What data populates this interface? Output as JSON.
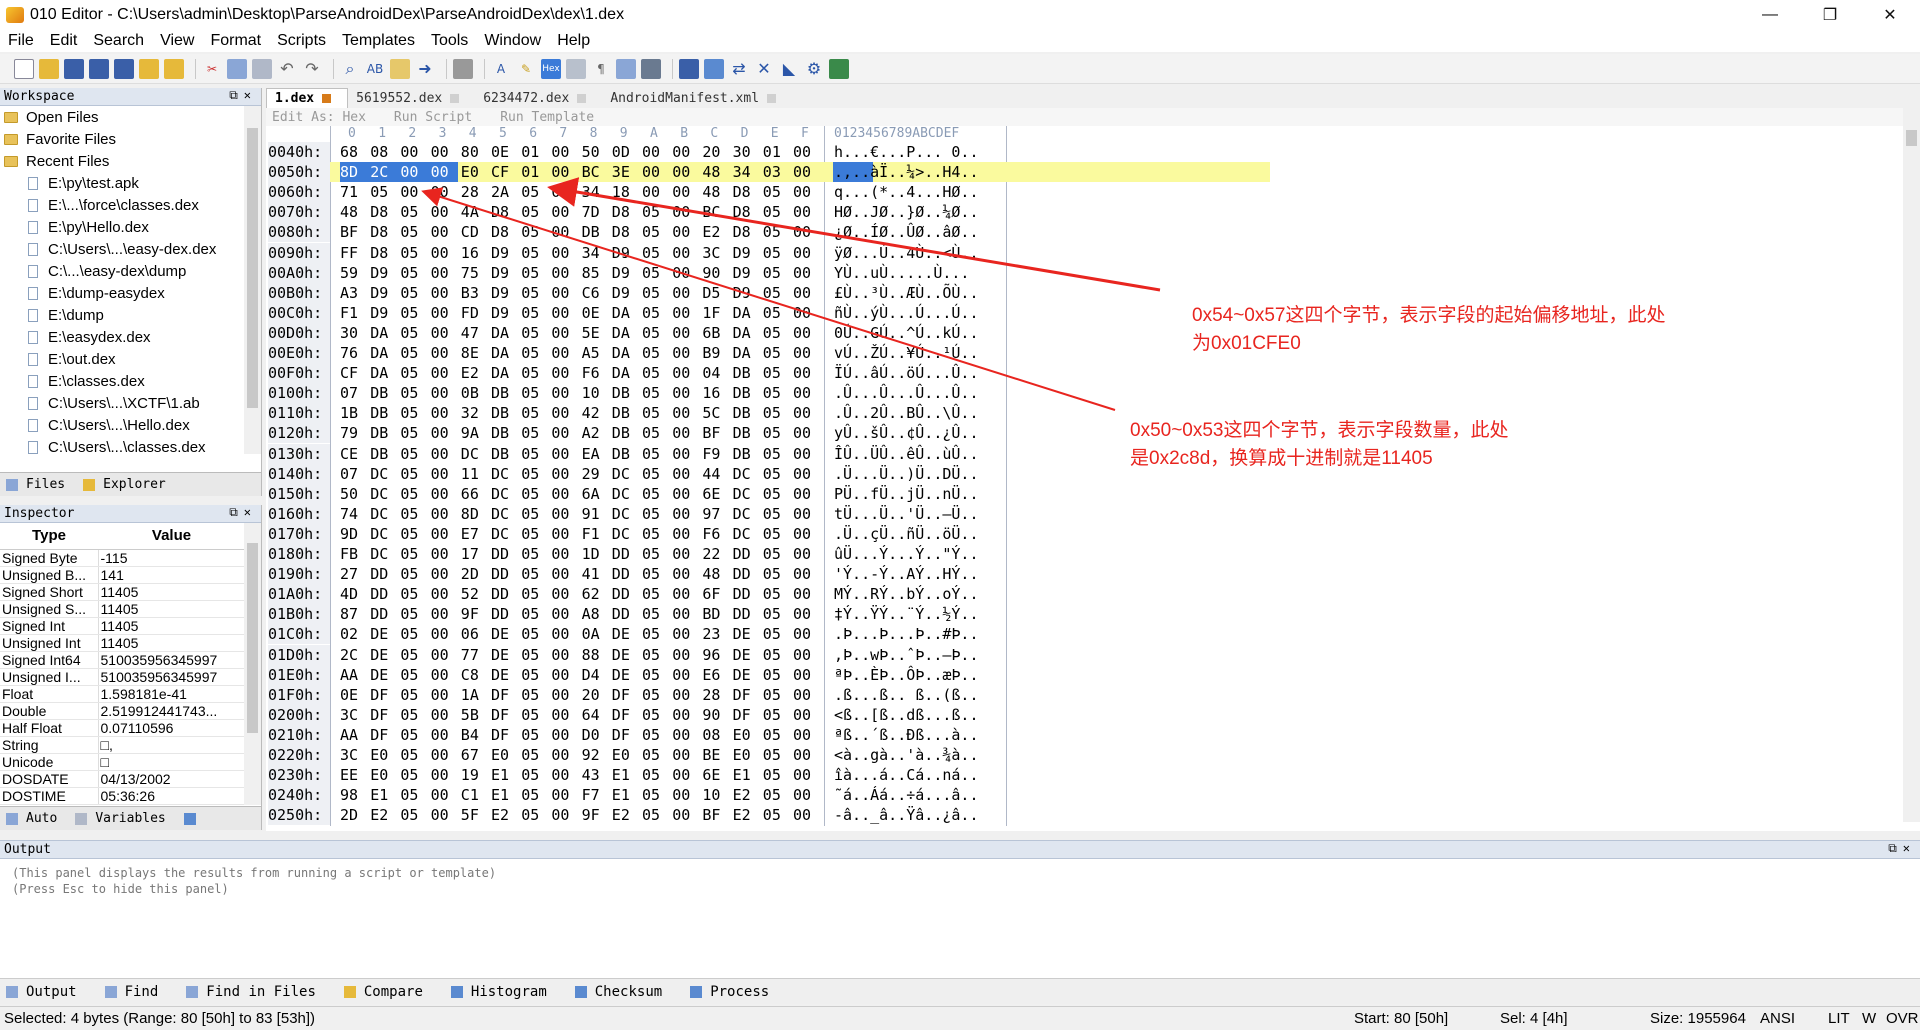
{
  "window": {
    "title": "010 Editor - C:\\Users\\admin\\Desktop\\ParseAndroidDex\\ParseAndroidDex\\dex\\1.dex",
    "controls": [
      "—",
      "❐",
      "✕"
    ]
  },
  "menu": [
    "File",
    "Edit",
    "Search",
    "View",
    "Format",
    "Scripts",
    "Templates",
    "Tools",
    "Window",
    "Help"
  ],
  "workspace": {
    "title": "Workspace",
    "items": [
      {
        "label": "Open Files",
        "type": "folder",
        "level": 0
      },
      {
        "label": "Favorite Files",
        "type": "folder",
        "level": 0
      },
      {
        "label": "Recent Files",
        "type": "folder",
        "level": 0
      },
      {
        "label": "E:\\py\\test.apk",
        "type": "file",
        "level": 1
      },
      {
        "label": "E:\\...\\force\\classes.dex",
        "type": "file",
        "level": 1
      },
      {
        "label": "E:\\py\\Hello.dex",
        "type": "file",
        "level": 1
      },
      {
        "label": "C:\\Users\\...\\easy-dex.dex",
        "type": "file",
        "level": 1
      },
      {
        "label": "C:\\...\\easy-dex\\dump",
        "type": "file",
        "level": 1
      },
      {
        "label": "E:\\dump-easydex",
        "type": "file",
        "level": 1
      },
      {
        "label": "E:\\dump",
        "type": "file",
        "level": 1
      },
      {
        "label": "E:\\easydex.dex",
        "type": "file",
        "level": 1
      },
      {
        "label": "E:\\out.dex",
        "type": "file",
        "level": 1
      },
      {
        "label": "E:\\classes.dex",
        "type": "file",
        "level": 1
      },
      {
        "label": "C:\\Users\\...\\XCTF\\1.ab",
        "type": "file",
        "level": 1
      },
      {
        "label": "C:\\Users\\...\\Hello.dex",
        "type": "file",
        "level": 1
      },
      {
        "label": "C:\\Users\\...\\classes.dex",
        "type": "file",
        "level": 1
      }
    ],
    "tabs": [
      "Files",
      "Explorer"
    ]
  },
  "inspector": {
    "title": "Inspector",
    "headers": [
      "Type",
      "Value"
    ],
    "rows": [
      [
        "Signed Byte",
        "-115"
      ],
      [
        "Unsigned B...",
        "141"
      ],
      [
        "Signed Short",
        "11405"
      ],
      [
        "Unsigned S...",
        "11405"
      ],
      [
        "Signed Int",
        "11405"
      ],
      [
        "Unsigned Int",
        "11405"
      ],
      [
        "Signed Int64",
        "510035956345997"
      ],
      [
        "Unsigned I...",
        "510035956345997"
      ],
      [
        "Float",
        "1.598181e-41"
      ],
      [
        "Double",
        "2.519912441743..."
      ],
      [
        "Half Float",
        "0.07110596"
      ],
      [
        "String",
        "□,"
      ],
      [
        "Unicode",
        "□"
      ],
      [
        "DOSDATE",
        "04/13/2002"
      ],
      [
        "DOSTIME",
        "05:36:26"
      ]
    ],
    "tabs": [
      "Auto",
      "Variables"
    ]
  },
  "editor": {
    "file_tabs": [
      "1.dex",
      "5619552.dex",
      "6234472.dex",
      "AndroidManifest.xml"
    ],
    "edit_as": "Edit As: Hex",
    "run_script": "Run Script",
    "run_template": "Run Template",
    "col_header_hex": [
      "0",
      "1",
      "2",
      "3",
      "4",
      "5",
      "6",
      "7",
      "8",
      "9",
      "A",
      "B",
      "C",
      "D",
      "E",
      "F"
    ],
    "col_header_ascii": "0123456789ABCDEF",
    "rows": [
      {
        "addr": "0040h:",
        "bytes": [
          "68",
          "08",
          "00",
          "00",
          "80",
          "0E",
          "01",
          "00",
          "50",
          "0D",
          "00",
          "00",
          "20",
          "30",
          "01",
          "00"
        ],
        "ascii": "h...€...P... 0.."
      },
      {
        "addr": "0050h:",
        "bytes": [
          "8D",
          "2C",
          "00",
          "00",
          "E0",
          "CF",
          "01",
          "00",
          "BC",
          "3E",
          "00",
          "00",
          "48",
          "34",
          "03",
          "00"
        ],
        "ascii": ".,..àÏ..¼>..H4.."
      },
      {
        "addr": "0060h:",
        "bytes": [
          "71",
          "05",
          "00",
          "00",
          "28",
          "2A",
          "05",
          "00",
          "34",
          "18",
          "00",
          "00",
          "48",
          "D8",
          "05",
          "00"
        ],
        "ascii": "q...(*..4...HØ.."
      },
      {
        "addr": "0070h:",
        "bytes": [
          "48",
          "D8",
          "05",
          "00",
          "4A",
          "D8",
          "05",
          "00",
          "7D",
          "D8",
          "05",
          "00",
          "BC",
          "D8",
          "05",
          "00"
        ],
        "ascii": "HØ..JØ..}Ø..¼Ø.."
      },
      {
        "addr": "0080h:",
        "bytes": [
          "BF",
          "D8",
          "05",
          "00",
          "CD",
          "D8",
          "05",
          "00",
          "DB",
          "D8",
          "05",
          "00",
          "E2",
          "D8",
          "05",
          "00"
        ],
        "ascii": "¿Ø..ÍØ..ÛØ..âØ.."
      },
      {
        "addr": "0090h:",
        "bytes": [
          "FF",
          "D8",
          "05",
          "00",
          "16",
          "D9",
          "05",
          "00",
          "34",
          "D9",
          "05",
          "00",
          "3C",
          "D9",
          "05",
          "00"
        ],
        "ascii": "ÿØ...Ù..4Ù..<Ù.."
      },
      {
        "addr": "00A0h:",
        "bytes": [
          "59",
          "D9",
          "05",
          "00",
          "75",
          "D9",
          "05",
          "00",
          "85",
          "D9",
          "05",
          "00",
          "90",
          "D9",
          "05",
          "00"
        ],
        "ascii": "YÙ..uÙ.....Ù..."
      },
      {
        "addr": "00B0h:",
        "bytes": [
          "A3",
          "D9",
          "05",
          "00",
          "B3",
          "D9",
          "05",
          "00",
          "C6",
          "D9",
          "05",
          "00",
          "D5",
          "D9",
          "05",
          "00"
        ],
        "ascii": "£Ù..³Ù..ÆÙ..ÕÙ.."
      },
      {
        "addr": "00C0h:",
        "bytes": [
          "F1",
          "D9",
          "05",
          "00",
          "FD",
          "D9",
          "05",
          "00",
          "0E",
          "DA",
          "05",
          "00",
          "1F",
          "DA",
          "05",
          "00"
        ],
        "ascii": "ñÙ..ýÙ...Ú...Ú.."
      },
      {
        "addr": "00D0h:",
        "bytes": [
          "30",
          "DA",
          "05",
          "00",
          "47",
          "DA",
          "05",
          "00",
          "5E",
          "DA",
          "05",
          "00",
          "6B",
          "DA",
          "05",
          "00"
        ],
        "ascii": "0Ú..GÚ..^Ú..kÚ.."
      },
      {
        "addr": "00E0h:",
        "bytes": [
          "76",
          "DA",
          "05",
          "00",
          "8E",
          "DA",
          "05",
          "00",
          "A5",
          "DA",
          "05",
          "00",
          "B9",
          "DA",
          "05",
          "00"
        ],
        "ascii": "vÚ..ŽÚ..¥Ú..¹Ú.."
      },
      {
        "addr": "00F0h:",
        "bytes": [
          "CF",
          "DA",
          "05",
          "00",
          "E2",
          "DA",
          "05",
          "00",
          "F6",
          "DA",
          "05",
          "00",
          "04",
          "DB",
          "05",
          "00"
        ],
        "ascii": "ÏÚ..âÚ..öÚ...Û.."
      },
      {
        "addr": "0100h:",
        "bytes": [
          "07",
          "DB",
          "05",
          "00",
          "0B",
          "DB",
          "05",
          "00",
          "10",
          "DB",
          "05",
          "00",
          "16",
          "DB",
          "05",
          "00"
        ],
        "ascii": ".Û...Û...Û...Û.."
      },
      {
        "addr": "0110h:",
        "bytes": [
          "1B",
          "DB",
          "05",
          "00",
          "32",
          "DB",
          "05",
          "00",
          "42",
          "DB",
          "05",
          "00",
          "5C",
          "DB",
          "05",
          "00"
        ],
        "ascii": ".Û..2Û..BÛ..\\Û.."
      },
      {
        "addr": "0120h:",
        "bytes": [
          "79",
          "DB",
          "05",
          "00",
          "9A",
          "DB",
          "05",
          "00",
          "A2",
          "DB",
          "05",
          "00",
          "BF",
          "DB",
          "05",
          "00"
        ],
        "ascii": "yÛ..šÛ..¢Û..¿Û.."
      },
      {
        "addr": "0130h:",
        "bytes": [
          "CE",
          "DB",
          "05",
          "00",
          "DC",
          "DB",
          "05",
          "00",
          "EA",
          "DB",
          "05",
          "00",
          "F9",
          "DB",
          "05",
          "00"
        ],
        "ascii": "ÎÛ..ÜÛ..êÛ..ùÛ.."
      },
      {
        "addr": "0140h:",
        "bytes": [
          "07",
          "DC",
          "05",
          "00",
          "11",
          "DC",
          "05",
          "00",
          "29",
          "DC",
          "05",
          "00",
          "44",
          "DC",
          "05",
          "00"
        ],
        "ascii": ".Ü...Ü..)Ü..DÜ.."
      },
      {
        "addr": "0150h:",
        "bytes": [
          "50",
          "DC",
          "05",
          "00",
          "66",
          "DC",
          "05",
          "00",
          "6A",
          "DC",
          "05",
          "00",
          "6E",
          "DC",
          "05",
          "00"
        ],
        "ascii": "PÜ..fÜ..jÜ..nÜ.."
      },
      {
        "addr": "0160h:",
        "bytes": [
          "74",
          "DC",
          "05",
          "00",
          "8D",
          "DC",
          "05",
          "00",
          "91",
          "DC",
          "05",
          "00",
          "97",
          "DC",
          "05",
          "00"
        ],
        "ascii": "tÜ...Ü..'Ü..—Ü.."
      },
      {
        "addr": "0170h:",
        "bytes": [
          "9D",
          "DC",
          "05",
          "00",
          "E7",
          "DC",
          "05",
          "00",
          "F1",
          "DC",
          "05",
          "00",
          "F6",
          "DC",
          "05",
          "00"
        ],
        "ascii": ".Ü..çÜ..ñÜ..öÜ.."
      },
      {
        "addr": "0180h:",
        "bytes": [
          "FB",
          "DC",
          "05",
          "00",
          "17",
          "DD",
          "05",
          "00",
          "1D",
          "DD",
          "05",
          "00",
          "22",
          "DD",
          "05",
          "00"
        ],
        "ascii": "ûÜ...Ý...Ý..\"Ý.."
      },
      {
        "addr": "0190h:",
        "bytes": [
          "27",
          "DD",
          "05",
          "00",
          "2D",
          "DD",
          "05",
          "00",
          "41",
          "DD",
          "05",
          "00",
          "48",
          "DD",
          "05",
          "00"
        ],
        "ascii": "'Ý..-Ý..AÝ..HÝ.."
      },
      {
        "addr": "01A0h:",
        "bytes": [
          "4D",
          "DD",
          "05",
          "00",
          "52",
          "DD",
          "05",
          "00",
          "62",
          "DD",
          "05",
          "00",
          "6F",
          "DD",
          "05",
          "00"
        ],
        "ascii": "MÝ..RÝ..bÝ..oÝ.."
      },
      {
        "addr": "01B0h:",
        "bytes": [
          "87",
          "DD",
          "05",
          "00",
          "9F",
          "DD",
          "05",
          "00",
          "A8",
          "DD",
          "05",
          "00",
          "BD",
          "DD",
          "05",
          "00"
        ],
        "ascii": "‡Ý..ŸÝ..¨Ý..½Ý.."
      },
      {
        "addr": "01C0h:",
        "bytes": [
          "02",
          "DE",
          "05",
          "00",
          "06",
          "DE",
          "05",
          "00",
          "0A",
          "DE",
          "05",
          "00",
          "23",
          "DE",
          "05",
          "00"
        ],
        "ascii": ".Þ...Þ...Þ..#Þ.."
      },
      {
        "addr": "01D0h:",
        "bytes": [
          "2C",
          "DE",
          "05",
          "00",
          "77",
          "DE",
          "05",
          "00",
          "88",
          "DE",
          "05",
          "00",
          "96",
          "DE",
          "05",
          "00"
        ],
        "ascii": ",Þ..wÞ..ˆÞ..–Þ.."
      },
      {
        "addr": "01E0h:",
        "bytes": [
          "AA",
          "DE",
          "05",
          "00",
          "C8",
          "DE",
          "05",
          "00",
          "D4",
          "DE",
          "05",
          "00",
          "E6",
          "DE",
          "05",
          "00"
        ],
        "ascii": "ªÞ..ÈÞ..ÔÞ..æÞ.."
      },
      {
        "addr": "01F0h:",
        "bytes": [
          "0E",
          "DF",
          "05",
          "00",
          "1A",
          "DF",
          "05",
          "00",
          "20",
          "DF",
          "05",
          "00",
          "28",
          "DF",
          "05",
          "00"
        ],
        "ascii": ".ß...ß.. ß..(ß.."
      },
      {
        "addr": "0200h:",
        "bytes": [
          "3C",
          "DF",
          "05",
          "00",
          "5B",
          "DF",
          "05",
          "00",
          "64",
          "DF",
          "05",
          "00",
          "90",
          "DF",
          "05",
          "00"
        ],
        "ascii": "<ß..[ß..dß...ß.."
      },
      {
        "addr": "0210h:",
        "bytes": [
          "AA",
          "DF",
          "05",
          "00",
          "B4",
          "DF",
          "05",
          "00",
          "D0",
          "DF",
          "05",
          "00",
          "08",
          "E0",
          "05",
          "00"
        ],
        "ascii": "ªß..´ß..Ðß...à.."
      },
      {
        "addr": "0220h:",
        "bytes": [
          "3C",
          "E0",
          "05",
          "00",
          "67",
          "E0",
          "05",
          "00",
          "92",
          "E0",
          "05",
          "00",
          "BE",
          "E0",
          "05",
          "00"
        ],
        "ascii": "<à..gà..'à..¾à.."
      },
      {
        "addr": "0230h:",
        "bytes": [
          "EE",
          "E0",
          "05",
          "00",
          "19",
          "E1",
          "05",
          "00",
          "43",
          "E1",
          "05",
          "00",
          "6E",
          "E1",
          "05",
          "00"
        ],
        "ascii": "îà...á..Cá..ná.."
      },
      {
        "addr": "0240h:",
        "bytes": [
          "98",
          "E1",
          "05",
          "00",
          "C1",
          "E1",
          "05",
          "00",
          "F7",
          "E1",
          "05",
          "00",
          "10",
          "E2",
          "05",
          "00"
        ],
        "ascii": "˜á..Áá..÷á...â.."
      },
      {
        "addr": "0250h:",
        "bytes": [
          "2D",
          "E2",
          "05",
          "00",
          "5F",
          "E2",
          "05",
          "00",
          "9F",
          "E2",
          "05",
          "00",
          "BF",
          "E2",
          "05",
          "00"
        ],
        "ascii": "-â.._â..Ÿâ..¿â.."
      }
    ]
  },
  "annotations": {
    "offset_note_line1": "0x54~0x57这四个字节，表示字段的起始偏移地址，此处",
    "offset_note_line2": "为0x01CFE0",
    "count_note_line1": "0x50~0x53这四个字节，表示字段数量，此处",
    "count_note_line2": "是0x2c8d，换算成十进制就是11405",
    "color": "#e8251f"
  },
  "output": {
    "title": "Output",
    "lines": [
      "(This panel displays the results from running a script or template)",
      "(Press Esc to hide this panel)"
    ],
    "tabs": [
      "Output",
      "Find",
      "Find in Files",
      "Compare",
      "Histogram",
      "Checksum",
      "Process"
    ]
  },
  "status": {
    "selected": "Selected: 4 bytes (Range: 80 [50h] to 83 [53h])",
    "start": "Start: 80 [50h]",
    "sel": "Sel: 4 [4h]",
    "size": "Size: 1955964",
    "encoding": "ANSI",
    "lit": "LIT",
    "w": "W",
    "ovr": "OVR"
  }
}
